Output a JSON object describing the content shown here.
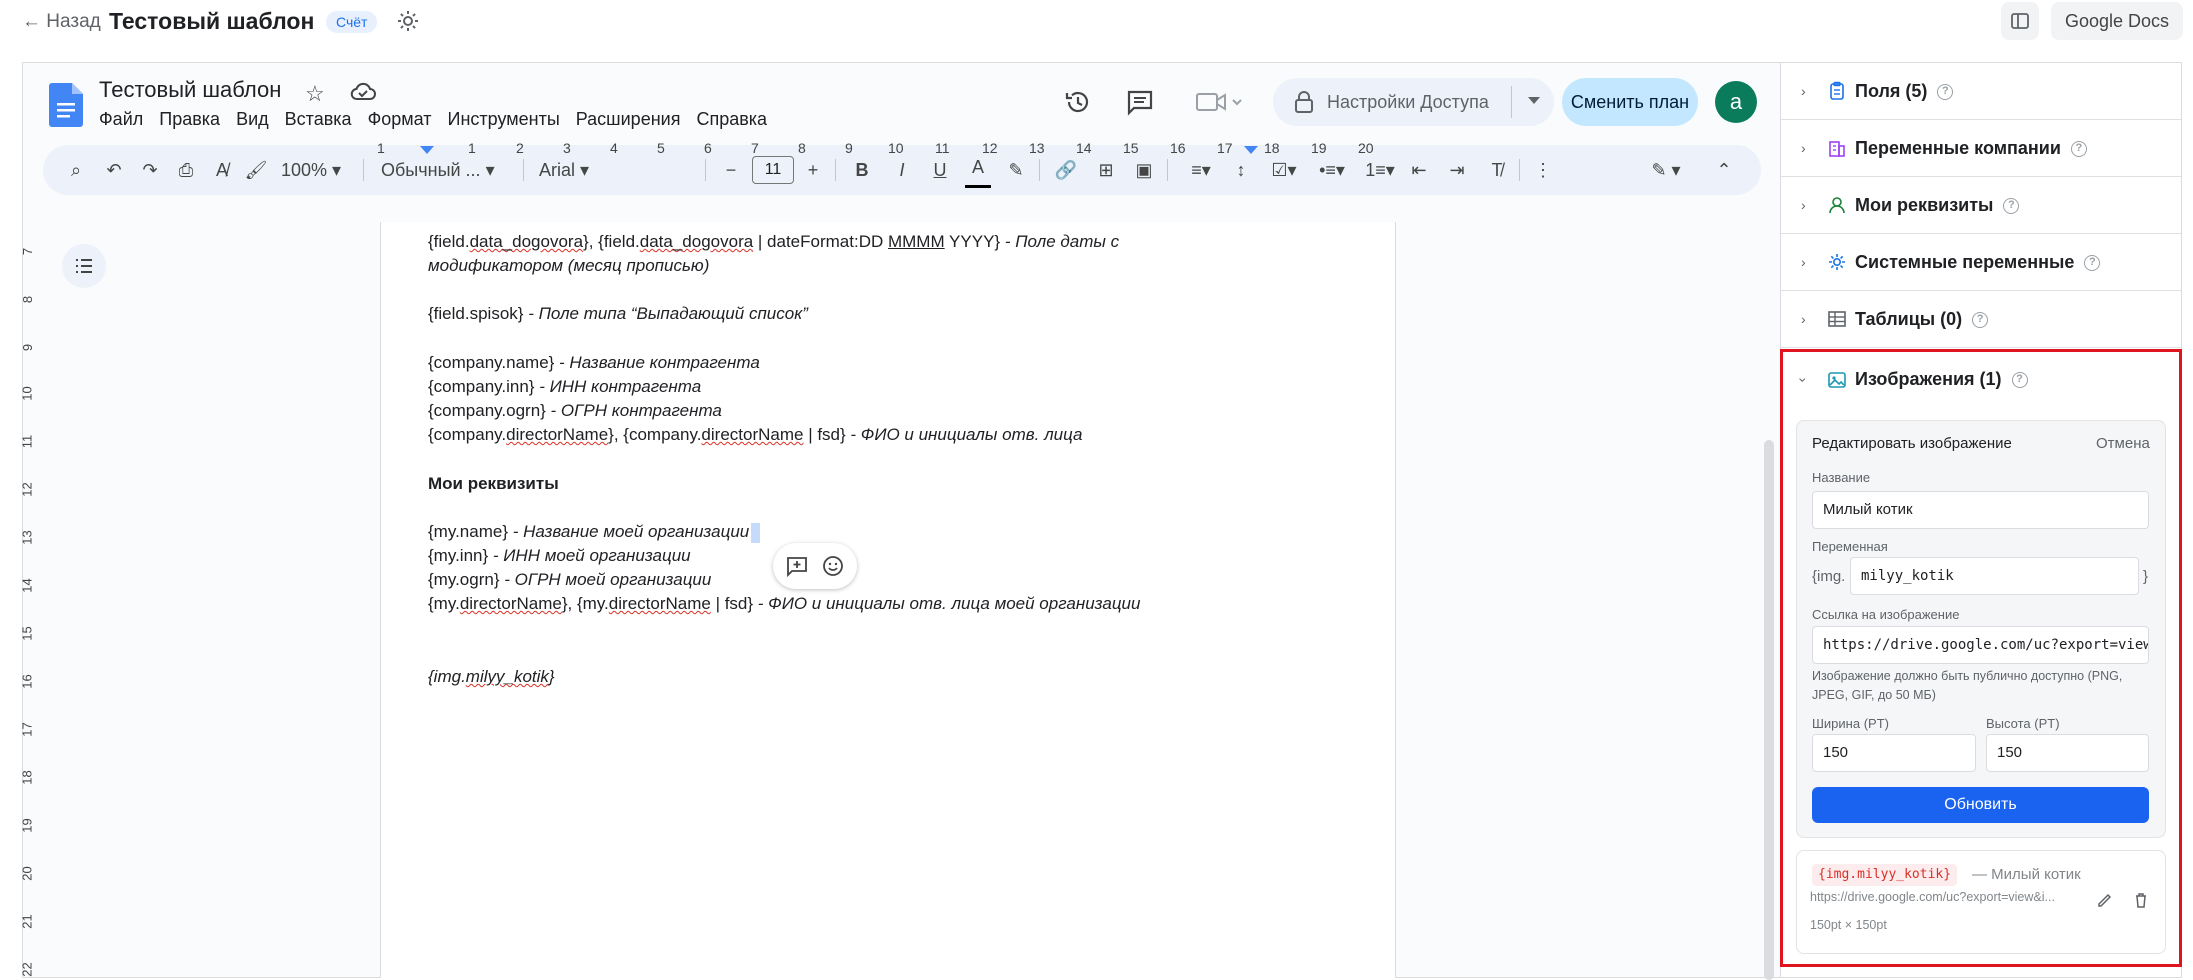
{
  "topbar": {
    "back_label": "← Назад",
    "title": "Тестовый шаблон",
    "badge": "Счёт",
    "google_docs_label": "Google Docs"
  },
  "docs": {
    "doc_name": "Тестовый шаблон",
    "menu": [
      "Файл",
      "Правка",
      "Вид",
      "Вставка",
      "Формат",
      "Инструменты",
      "Расширения",
      "Справка"
    ],
    "access_label": "Настройки Доступа",
    "plan_label": "Сменить план",
    "avatar_letter": "a",
    "toolbar": {
      "zoom": "100%",
      "style": "Обычный ...",
      "font": "Arial",
      "font_size": "11"
    },
    "ruler_h": [
      "1",
      "1",
      "2",
      "3",
      "4",
      "5",
      "6",
      "7",
      "8",
      "9",
      "10",
      "11",
      "12",
      "13",
      "14",
      "15",
      "16",
      "17",
      "18",
      "19",
      "20"
    ],
    "ruler_v": [
      "7",
      "8",
      "9",
      "10",
      "11",
      "12",
      "13",
      "14",
      "15",
      "16",
      "17",
      "18",
      "19",
      "20",
      "21",
      "22"
    ],
    "lines": {
      "l1a": "{field.",
      "l1b": "data_dogovora",
      "l1c": "}, {field.",
      "l1d": "data_dogovora",
      "l1e": " | dateFormat:DD ",
      "l1f": "MMMM",
      "l1g": " YYYY} ",
      "l1h": "- Поле даты с",
      "l2": "модификатором (месяц прописью)",
      "l3a": "{field.spisok} ",
      "l3b": "- Поле типа “Выпадающий список”",
      "l4a": "{company.name} ",
      "l4b": "- Название контрагента",
      "l5a": "{company.inn} ",
      "l5b": "- ИНН контрагента",
      "l6a": "{company.ogrn} ",
      "l6b": "- ОГРН контрагента",
      "l7a": "{company.",
      "l7b": "directorName",
      "l7c": "}, {company.",
      "l7d": "directorName",
      "l7e": " | fsd} ",
      "l7f": "- ФИО и инициалы отв. лица",
      "l8": "Мои реквизиты",
      "l9a": "{my.name} ",
      "l9b": "- Название моей организации",
      "l10a": "{my.inn} ",
      "l10b": "- ИНН моей организации",
      "l11a": "{my.ogrn} ",
      "l11b": "- ОГРН моей организации",
      "l12a": "{my.",
      "l12b": "directorName",
      "l12c": "}, {my.",
      "l12d": "directorName",
      "l12e": " | fsd} ",
      "l12f": "- ФИО и инициалы отв. лица моей организации",
      "l13a": "{img.",
      "l13b": "milyy_kotik",
      "l13c": "}"
    }
  },
  "panel": {
    "sections": [
      {
        "title": "Поля (5)"
      },
      {
        "title": "Переменные компании"
      },
      {
        "title": "Мои реквизиты"
      },
      {
        "title": "Системные переменные"
      },
      {
        "title": "Таблицы (0)"
      },
      {
        "title": "Изображения (1)"
      }
    ],
    "edit": {
      "heading": "Редактировать изображение",
      "cancel": "Отмена",
      "name_label": "Название",
      "name_value": "Милый котик",
      "var_label": "Переменная",
      "var_prefix": "{img.",
      "var_value": "milyy_kotik",
      "var_suffix": "}",
      "url_label": "Ссылка на изображение",
      "url_value": "https://drive.google.com/uc?export=view",
      "hint": "Изображение должно быть публично доступно (PNG, JPEG, GIF, до 50 МБ)",
      "width_label": "Ширина (PT)",
      "width_value": "150",
      "height_label": "Высота (PT)",
      "height_value": "150",
      "update_label": "Обновить"
    },
    "item": {
      "code": "{img.milyy_kotik}",
      "name": "— Милый котик",
      "url": "https://drive.google.com/uc?export=view&i...",
      "size": "150pt × 150pt"
    }
  },
  "colors": {
    "accent": "#1a62f0",
    "highlight": "#e0141e",
    "avatar": "#0a7c5c"
  }
}
